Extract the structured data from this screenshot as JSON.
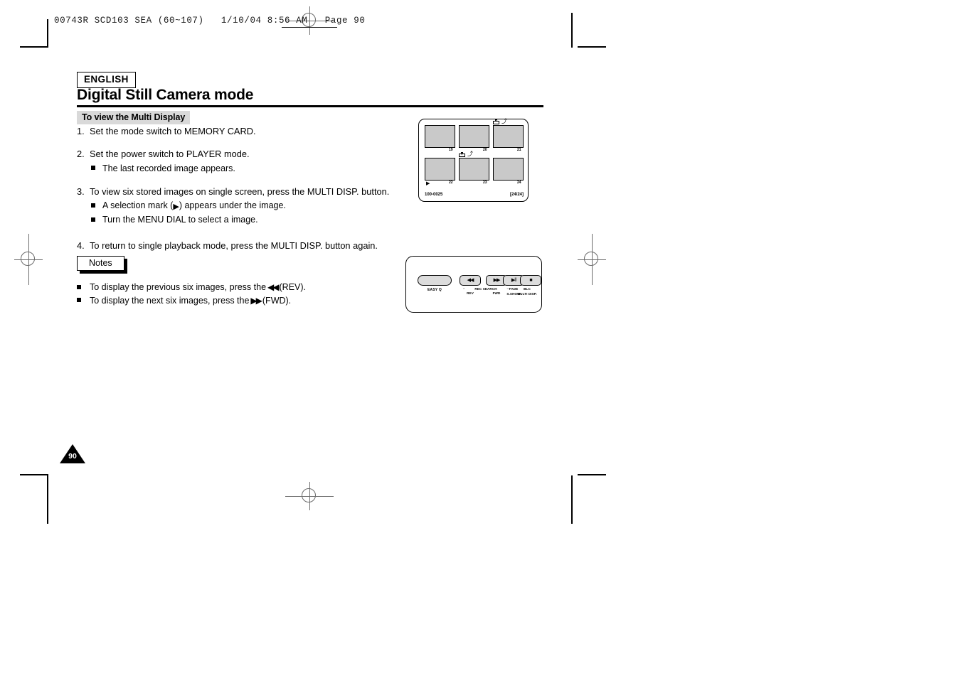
{
  "slug": {
    "text": "00743R SCD103 SEA (60~107)   1/10/04 8:56 AM   Page 90"
  },
  "header": {
    "language_badge": "ENGLISH",
    "title": "Digital Still Camera mode",
    "section": "To view the Multi Display"
  },
  "steps": [
    {
      "num": "1.",
      "text": "Set the mode switch to MEMORY CARD.",
      "subs": []
    },
    {
      "num": "2.",
      "text": "Set the power switch to PLAYER mode.",
      "subs": [
        {
          "pre": "The last recorded image appears.",
          "glyph": "",
          "post": ""
        }
      ]
    },
    {
      "num": "3.",
      "text": "To view six stored images on single screen, press the MULTI DISP. button.",
      "subs": [
        {
          "pre": "A selection mark (",
          "glyph": "▶",
          "post": ") appears under the image."
        },
        {
          "pre": "Turn the MENU DIAL to select a image.",
          "glyph": "",
          "post": ""
        }
      ]
    },
    {
      "num": "4.",
      "text": "To return to single playback mode, press the MULTI DISP. button again.",
      "subs": []
    }
  ],
  "notes": {
    "label": "Notes",
    "items": [
      {
        "pre": "To display the previous six images, press the",
        "glyph": "◀◀",
        "post": "(REV)."
      },
      {
        "pre": "To display the next six images, press the",
        "glyph": "▶▶",
        "post": "(FWD)."
      }
    ]
  },
  "lcd_figure": {
    "thumbnails": [
      {
        "number": "19",
        "icon": "",
        "selected": false
      },
      {
        "number": "20",
        "icon": "",
        "selected": false
      },
      {
        "number": "21",
        "icon": "lock-icon",
        "selected": false
      },
      {
        "number": "22",
        "icon": "",
        "selected": true
      },
      {
        "number": "23",
        "icon": "print-mark-icon",
        "selected": false
      },
      {
        "number": "24",
        "icon": "",
        "selected": false
      }
    ],
    "selection_mark": "▶",
    "file_label": "100-0025",
    "counter": "[24/24]"
  },
  "remote_figure": {
    "easy_button": {
      "label": "EASY",
      "suffix": "Q"
    },
    "rec_search_label": "REC SEARCH",
    "buttons": [
      {
        "glyph": "◀◀",
        "label_top": "",
        "label_bottom": "REV",
        "name": "rev-button"
      },
      {
        "glyph": "▶▶",
        "label_top": "",
        "label_bottom": "FWD",
        "name": "fwd-button"
      },
      {
        "glyph": "▶‖",
        "label_top": "FADE",
        "label_bottom": "S.SHOW",
        "name": "fade-sshow-button"
      },
      {
        "glyph": "■",
        "label_top": "BLC",
        "label_bottom": "MULTI DISP.",
        "name": "blc-multidisp-button"
      }
    ]
  },
  "folio": {
    "page_number": "90"
  }
}
